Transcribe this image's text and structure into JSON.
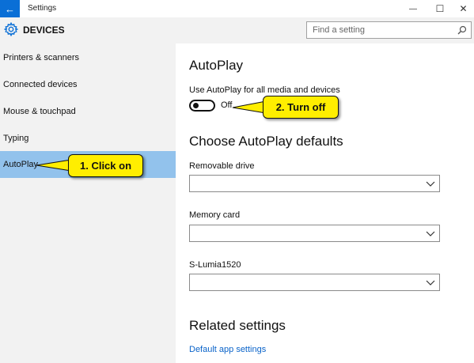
{
  "window": {
    "title": "Settings",
    "back_glyph": "←",
    "minimize_glyph": "—",
    "maximize_glyph": "☐",
    "close_glyph": "✕"
  },
  "header": {
    "title": "DEVICES",
    "icon": "gear-icon",
    "search_placeholder": "Find a setting",
    "search_icon": "search-icon"
  },
  "sidebar": {
    "items": [
      {
        "label": "Printers & scanners",
        "active": false
      },
      {
        "label": "Connected devices",
        "active": false
      },
      {
        "label": "Mouse & touchpad",
        "active": false
      },
      {
        "label": "Typing",
        "active": false
      },
      {
        "label": "AutoPlay",
        "active": true
      }
    ]
  },
  "main": {
    "title": "AutoPlay",
    "toggle_label": "Use AutoPlay for all media and devices",
    "toggle_state": "Off",
    "defaults_title": "Choose AutoPlay defaults",
    "dropdowns": [
      {
        "label": "Removable drive",
        "value": ""
      },
      {
        "label": "Memory card",
        "value": ""
      },
      {
        "label": "S-Lumia1520",
        "value": ""
      }
    ],
    "related_title": "Related settings",
    "related_link": "Default app settings"
  },
  "annotations": {
    "step1": "1. Click on",
    "step2": "2. Turn off",
    "color": "#ffee00"
  },
  "colors": {
    "accent": "#0a6fd6",
    "sidebar_bg": "#f2f2f2",
    "active_item": "#92c2ec",
    "link": "#0a63c9"
  }
}
